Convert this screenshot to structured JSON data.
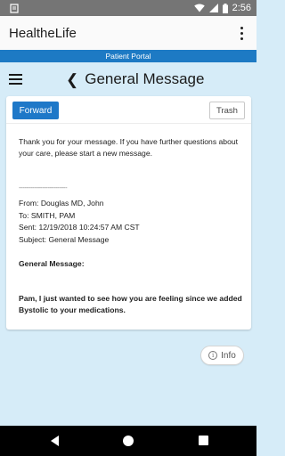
{
  "status_bar": {
    "time": "2:56"
  },
  "app_bar": {
    "title": "HealtheLife"
  },
  "portal": {
    "label": "Patient Portal"
  },
  "header": {
    "title": "General Message"
  },
  "actions": {
    "forward_label": "Forward",
    "trash_label": "Trash"
  },
  "message": {
    "intro": "Thank you for your message. If you have further questions about your care, please start a new message.",
    "divider": "-------------------------",
    "from": "From: Douglas MD, John",
    "to": "To: SMITH, PAM",
    "sent": "Sent: 12/19/2018 10:24:57 AM CST",
    "subject": "Subject: General Message",
    "general_label": "General Message:",
    "body": "Pam, I just wanted to see how you are feeling since we added Bystolic to your medications."
  },
  "info": {
    "label": "Info"
  },
  "colors": {
    "accent": "#1e78c8",
    "portal_bar": "#1d7ac4",
    "background": "#d6ecf8"
  }
}
